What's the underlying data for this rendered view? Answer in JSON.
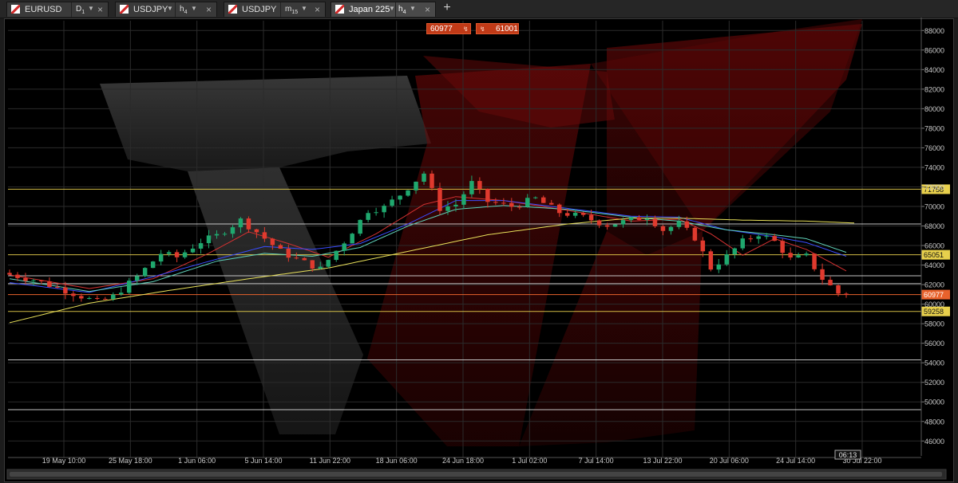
{
  "tabs": [
    {
      "symbol": "EURUSD",
      "timeframe": "D",
      "timeframe_sub": "1",
      "active": false
    },
    {
      "symbol": "USDJPY",
      "timeframe": "h",
      "timeframe_sub": "4",
      "active": false
    },
    {
      "symbol": "USDJPY",
      "timeframe": "m",
      "timeframe_sub": "15",
      "active": false
    },
    {
      "symbol": "Japan 225",
      "timeframe": "h",
      "timeframe_sub": "4",
      "active": true
    }
  ],
  "tab_close_glyph": "×",
  "tab_dropdown_glyph": "▼",
  "add_tab_glyph": "+",
  "quote": {
    "sell_price": "60977",
    "buy_price": "61001",
    "sell_icon": "chart-mini-icon",
    "buy_icon": "chart-mini-icon"
  },
  "colors": {
    "bull": "#1fa86e",
    "bear": "#e03a2e",
    "support_line": "#e8d04c",
    "white_line": "#d8d8d8",
    "current_price": "#e8622c",
    "ema_red": "#d33131",
    "ema_blue": "#3a4cff",
    "ema_teal": "#5fd0b8",
    "ema_yellow": "#e8e05a"
  },
  "chart_data": {
    "type": "candlestick",
    "instrument": "Japan 225",
    "timeframe": "h4",
    "ylim": [
      44800,
      89000
    ],
    "y_ticks": [
      46000,
      48000,
      50000,
      52000,
      54000,
      56000,
      58000,
      60000,
      62000,
      64000,
      66000,
      68000,
      70000,
      72000,
      74000,
      76000,
      78000,
      80000,
      82000,
      84000,
      86000,
      88000
    ],
    "x_labels": [
      "19 May 10:00",
      "25 May 18:00",
      "1 Jun 06:00",
      "5 Jun 14:00",
      "11 Jun 22:00",
      "18 Jun 06:00",
      "24 Jun 18:00",
      "1 Jul 02:00",
      "7 Jul 14:00",
      "13 Jul 22:00",
      "20 Jul 06:00",
      "24 Jul 14:00",
      "30 Jul 22:00"
    ],
    "crosshair_time": "06:13",
    "horizontal_levels": [
      {
        "price": 71758,
        "label": "71758",
        "style": "support"
      },
      {
        "price": 68200,
        "label": "",
        "style": "white"
      },
      {
        "price": 65051,
        "label": "65051",
        "style": "support"
      },
      {
        "price": 62900,
        "label": "",
        "style": "white"
      },
      {
        "price": 62100,
        "label": "",
        "style": "white"
      },
      {
        "price": 59258,
        "label": "59258",
        "style": "support"
      },
      {
        "price": 54300,
        "label": "",
        "style": "white"
      },
      {
        "price": 49200,
        "label": "",
        "style": "white"
      }
    ],
    "current_price": {
      "price": 60977,
      "label": "60977"
    },
    "price_path": [
      [
        0,
        63200
      ],
      [
        4,
        62500
      ],
      [
        8,
        61400
      ],
      [
        12,
        60200
      ],
      [
        14,
        60800
      ],
      [
        17,
        62800
      ],
      [
        20,
        65200
      ],
      [
        22,
        64800
      ],
      [
        25,
        66400
      ],
      [
        27,
        67000
      ],
      [
        30,
        68600
      ],
      [
        32,
        67400
      ],
      [
        35,
        65400
      ],
      [
        37,
        64600
      ],
      [
        40,
        63600
      ],
      [
        43,
        66400
      ],
      [
        46,
        69600
      ],
      [
        48,
        69900
      ],
      [
        50,
        71200
      ],
      [
        53,
        73400
      ],
      [
        55,
        69800
      ],
      [
        57,
        70200
      ],
      [
        59,
        72400
      ],
      [
        61,
        70500
      ],
      [
        64,
        70000
      ],
      [
        67,
        70800
      ],
      [
        70,
        69400
      ],
      [
        73,
        68900
      ],
      [
        76,
        68100
      ],
      [
        79,
        68600
      ],
      [
        81,
        69000
      ],
      [
        83,
        67600
      ],
      [
        85,
        68200
      ],
      [
        87,
        66800
      ],
      [
        89,
        63700
      ],
      [
        91,
        64900
      ],
      [
        93,
        66400
      ],
      [
        95,
        67200
      ],
      [
        97,
        66400
      ],
      [
        99,
        64600
      ],
      [
        101,
        64900
      ],
      [
        103,
        62600
      ],
      [
        105,
        61100
      ]
    ],
    "series": [
      {
        "name": "EMA red",
        "color_key": "ema_red",
        "points": [
          [
            0,
            63000
          ],
          [
            10,
            61600
          ],
          [
            18,
            62600
          ],
          [
            25,
            65200
          ],
          [
            30,
            67400
          ],
          [
            35,
            66200
          ],
          [
            40,
            64800
          ],
          [
            46,
            67200
          ],
          [
            52,
            70200
          ],
          [
            56,
            71000
          ],
          [
            62,
            70600
          ],
          [
            70,
            69600
          ],
          [
            78,
            68500
          ],
          [
            84,
            68700
          ],
          [
            88,
            67200
          ],
          [
            92,
            65000
          ],
          [
            96,
            66700
          ],
          [
            100,
            65600
          ],
          [
            105,
            63400
          ]
        ]
      },
      {
        "name": "EMA blue",
        "color_key": "ema_blue",
        "points": [
          [
            0,
            62200
          ],
          [
            10,
            61200
          ],
          [
            18,
            62800
          ],
          [
            26,
            64600
          ],
          [
            32,
            65900
          ],
          [
            38,
            65600
          ],
          [
            44,
            66200
          ],
          [
            50,
            68200
          ],
          [
            56,
            70600
          ],
          [
            62,
            70600
          ],
          [
            70,
            69800
          ],
          [
            78,
            69000
          ],
          [
            84,
            68900
          ],
          [
            90,
            67600
          ],
          [
            96,
            66900
          ],
          [
            100,
            66300
          ],
          [
            105,
            64900
          ]
        ]
      },
      {
        "name": "EMA teal",
        "color_key": "ema_teal",
        "points": [
          [
            0,
            62600
          ],
          [
            10,
            61300
          ],
          [
            18,
            62300
          ],
          [
            26,
            64400
          ],
          [
            32,
            65200
          ],
          [
            38,
            64900
          ],
          [
            44,
            65800
          ],
          [
            50,
            68000
          ],
          [
            56,
            69700
          ],
          [
            62,
            70100
          ],
          [
            70,
            69700
          ],
          [
            78,
            68900
          ],
          [
            84,
            68500
          ],
          [
            90,
            67600
          ],
          [
            96,
            67100
          ],
          [
            100,
            66700
          ],
          [
            105,
            65300
          ]
        ]
      },
      {
        "name": "EMA yellow",
        "color_key": "ema_yellow",
        "points": [
          [
            0,
            58100
          ],
          [
            10,
            60100
          ],
          [
            20,
            61400
          ],
          [
            30,
            62600
          ],
          [
            40,
            63700
          ],
          [
            50,
            65400
          ],
          [
            60,
            67100
          ],
          [
            70,
            68200
          ],
          [
            78,
            68800
          ],
          [
            84,
            68800
          ],
          [
            92,
            68600
          ],
          [
            100,
            68500
          ],
          [
            106,
            68300
          ]
        ]
      }
    ]
  }
}
